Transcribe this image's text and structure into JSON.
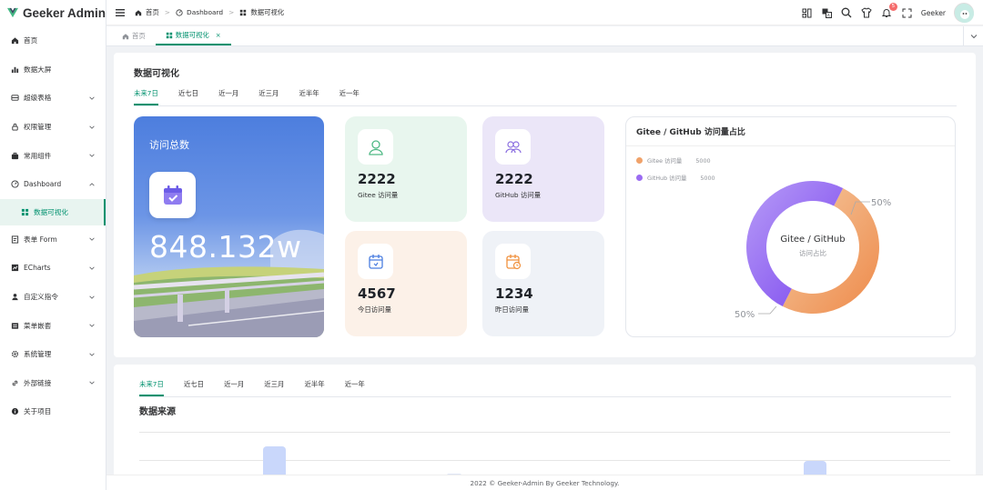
{
  "app": {
    "name": "Geeker Admin"
  },
  "sidebar": {
    "items": [
      {
        "label": "首页",
        "icon": "home-icon"
      },
      {
        "label": "数据大屏",
        "icon": "histogram-icon"
      },
      {
        "label": "超级表格",
        "icon": "table-icon",
        "expandable": true
      },
      {
        "label": "权限管理",
        "icon": "lock-icon",
        "expandable": true
      },
      {
        "label": "常用组件",
        "icon": "briefcase-icon",
        "expandable": true
      },
      {
        "label": "Dashboard",
        "icon": "odometer-icon",
        "expandable": true,
        "expanded": true
      },
      {
        "label": "数据可视化",
        "icon": "grid-icon",
        "sub": true,
        "active": true
      },
      {
        "label": "表单 Form",
        "icon": "tickets-icon",
        "expandable": true
      },
      {
        "label": "ECharts",
        "icon": "chart-icon",
        "expandable": true
      },
      {
        "label": "自定义指令",
        "icon": "user-icon",
        "expandable": true
      },
      {
        "label": "菜单嵌套",
        "icon": "menu-icon",
        "expandable": true
      },
      {
        "label": "系统管理",
        "icon": "setting-icon",
        "expandable": true
      },
      {
        "label": "外部链接",
        "icon": "link-icon",
        "expandable": true
      },
      {
        "label": "关于项目",
        "icon": "info-icon"
      }
    ]
  },
  "header": {
    "breadcrumb": [
      "首页",
      "Dashboard",
      "数据可视化"
    ],
    "username": "Geeker",
    "notification_count": "5"
  },
  "tabs": [
    {
      "label": "首页",
      "active": false
    },
    {
      "label": "数据可视化",
      "active": true
    }
  ],
  "top": {
    "title": "数据可视化",
    "filters": [
      "未来7日",
      "近七日",
      "近一月",
      "近三月",
      "近半年",
      "近一年"
    ],
    "active_filter": "未来7日",
    "total": {
      "label": "访问总数",
      "value": "848.132w"
    },
    "stats": [
      {
        "value": "2222",
        "label": "Gitee 访问量",
        "bg": "#e8f6ee",
        "icon": "user-icon"
      },
      {
        "value": "2222",
        "label": "GitHub 访问量",
        "bg": "#ebe6f8",
        "icon": "users-icon"
      },
      {
        "value": "4567",
        "label": "今日访问量",
        "bg": "#fcf1e8",
        "icon": "calendar-icon"
      },
      {
        "value": "1234",
        "label": "昨日访问量",
        "bg": "#eff2f7",
        "icon": "calendar-clock-icon"
      }
    ],
    "donut": {
      "title": "Gitee / GitHub 访问量占比",
      "center_title": "Gitee / GitHub",
      "center_sub": "访问占比",
      "legend": [
        {
          "name": "Gitee 访问量",
          "value": "5000",
          "color": "#f0a26a"
        },
        {
          "name": "GitHub 访问量",
          "value": "5000",
          "color": "#9b6cf2"
        }
      ],
      "label_top": "50%",
      "label_bottom": "50%"
    }
  },
  "bottom": {
    "filters": [
      "未来7日",
      "近七日",
      "近一月",
      "近三月",
      "近半年",
      "近一年"
    ],
    "active_filter": "未来7日",
    "title": "数据来源"
  },
  "footer": "2022 © Geeker-Admin By Geeker Technology."
}
